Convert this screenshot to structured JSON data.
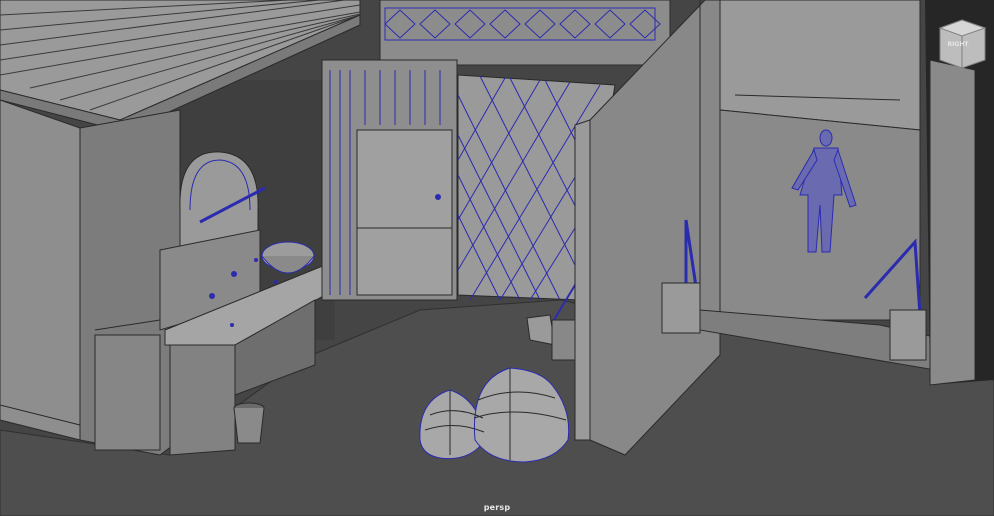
{
  "viewport": {
    "camera_label": "persp",
    "viewcube_face": "RIGHT"
  },
  "colors": {
    "background": "#454545",
    "wall_face": "#8f8f8f",
    "wall_dark": "#6f6f6f",
    "wire_blue": "#2b2bb0",
    "edge_line": "#2a2a2a",
    "label": "#e8e8e8"
  },
  "scene_objects": [
    "roof-tiles-mesh",
    "left-building-mesh",
    "wash-basin-mesh",
    "bowl-mesh",
    "bucket-mesh",
    "door-mesh",
    "lattice-fence-mesh",
    "broom-mesh",
    "garbage-bags-mesh",
    "front-wall-mesh",
    "human-figure-mesh",
    "stair-railing-mesh",
    "right-pillar-mesh"
  ]
}
